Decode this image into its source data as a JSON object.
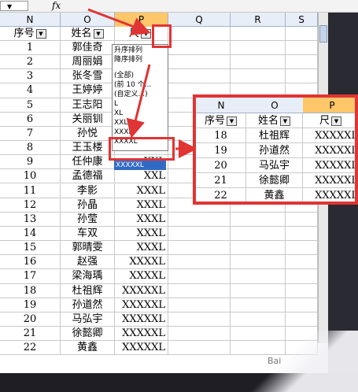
{
  "formula_bar": {
    "fx_label": "fx"
  },
  "columns": [
    "N",
    "O",
    "P",
    "Q",
    "R",
    "S"
  ],
  "headers": {
    "seq": "序号",
    "name": "姓名",
    "size": "尺"
  },
  "rows": [
    {
      "no": "1",
      "name": "郭佳奇",
      "size": ""
    },
    {
      "no": "2",
      "name": "周丽娟",
      "size": ""
    },
    {
      "no": "3",
      "name": "张冬雪",
      "size": ""
    },
    {
      "no": "4",
      "name": "王婷婷",
      "size": ""
    },
    {
      "no": "5",
      "name": "王志阳",
      "size": ""
    },
    {
      "no": "6",
      "name": "关丽钏",
      "size": ""
    },
    {
      "no": "7",
      "name": "孙悦",
      "size": ""
    },
    {
      "no": "8",
      "name": "王玉楼",
      "size": ""
    },
    {
      "no": "9",
      "name": "任仲康",
      "size": "XXL"
    },
    {
      "no": "10",
      "name": "孟德福",
      "size": "XXL"
    },
    {
      "no": "11",
      "name": "李影",
      "size": "XXXL"
    },
    {
      "no": "12",
      "name": "孙晶",
      "size": "XXXL"
    },
    {
      "no": "13",
      "name": "孙莹",
      "size": "XXXL"
    },
    {
      "no": "14",
      "name": "车双",
      "size": "XXXL"
    },
    {
      "no": "15",
      "name": "郭晴雯",
      "size": "XXXL"
    },
    {
      "no": "16",
      "name": "赵强",
      "size": "XXXXL"
    },
    {
      "no": "17",
      "name": "梁海瑀",
      "size": "XXXXL"
    },
    {
      "no": "18",
      "name": "杜祖辉",
      "size": "XXXXXL"
    },
    {
      "no": "19",
      "name": "孙道然",
      "size": "XXXXXL"
    },
    {
      "no": "20",
      "name": "马弘宇",
      "size": "XXXXXL"
    },
    {
      "no": "21",
      "name": "徐懿卿",
      "size": "XXXXXL"
    },
    {
      "no": "22",
      "name": "黄鑫",
      "size": "XXXXXL"
    }
  ],
  "filter_menu": {
    "items": [
      "升序排列",
      "降序排列",
      "(全部)",
      "(前 10 个...",
      "(自定义...)",
      "L",
      "XL",
      "XXL",
      "XXXL",
      "XXXXL"
    ],
    "selected": "XXXXXL"
  },
  "inset": {
    "columns": [
      "N",
      "O",
      "P"
    ],
    "rows": [
      {
        "no": "18",
        "name": "杜祖辉",
        "size": "XXXXXL"
      },
      {
        "no": "19",
        "name": "孙道然",
        "size": "XXXXXL"
      },
      {
        "no": "20",
        "name": "马弘宇",
        "size": "XXXXXL"
      },
      {
        "no": "21",
        "name": "徐懿卿",
        "size": "XXXXXL"
      },
      {
        "no": "22",
        "name": "黄鑫",
        "size": "XXXXXL"
      }
    ]
  },
  "colors": {
    "annotation_red": "#e13434",
    "selected_blue": "#316ac5",
    "selected_column": "#ffc66a",
    "header_bg": "#e8eef7"
  },
  "watermark": "Bai"
}
